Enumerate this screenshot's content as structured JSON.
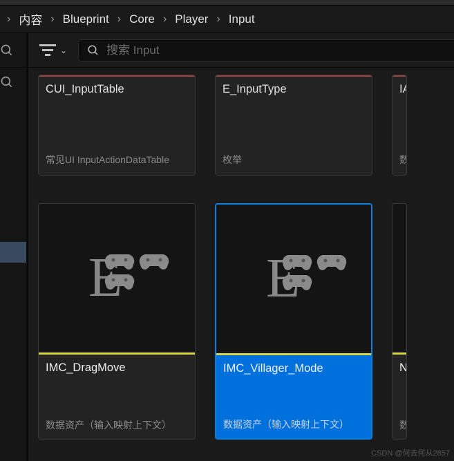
{
  "breadcrumb": {
    "items": [
      "内容",
      "Blueprint",
      "Core",
      "Player",
      "Input"
    ]
  },
  "toolbar": {
    "search_placeholder": "搜索 Input"
  },
  "assets": {
    "row1": [
      {
        "name": "CUI_InputTable",
        "desc": "常见UI InputActionDataTable"
      },
      {
        "name": "E_InputType",
        "desc": "枚举"
      },
      {
        "name": "IA",
        "desc": "数"
      }
    ],
    "row2": [
      {
        "name": "IMC_DragMove",
        "desc": "数据资产（输入映射上下文）"
      },
      {
        "name": "IMC_Villager_Mode",
        "desc": "数据资产（输入映射上下文）"
      },
      {
        "name": "N",
        "desc": "数"
      }
    ]
  },
  "watermark": "CSDN @何去何从2857"
}
